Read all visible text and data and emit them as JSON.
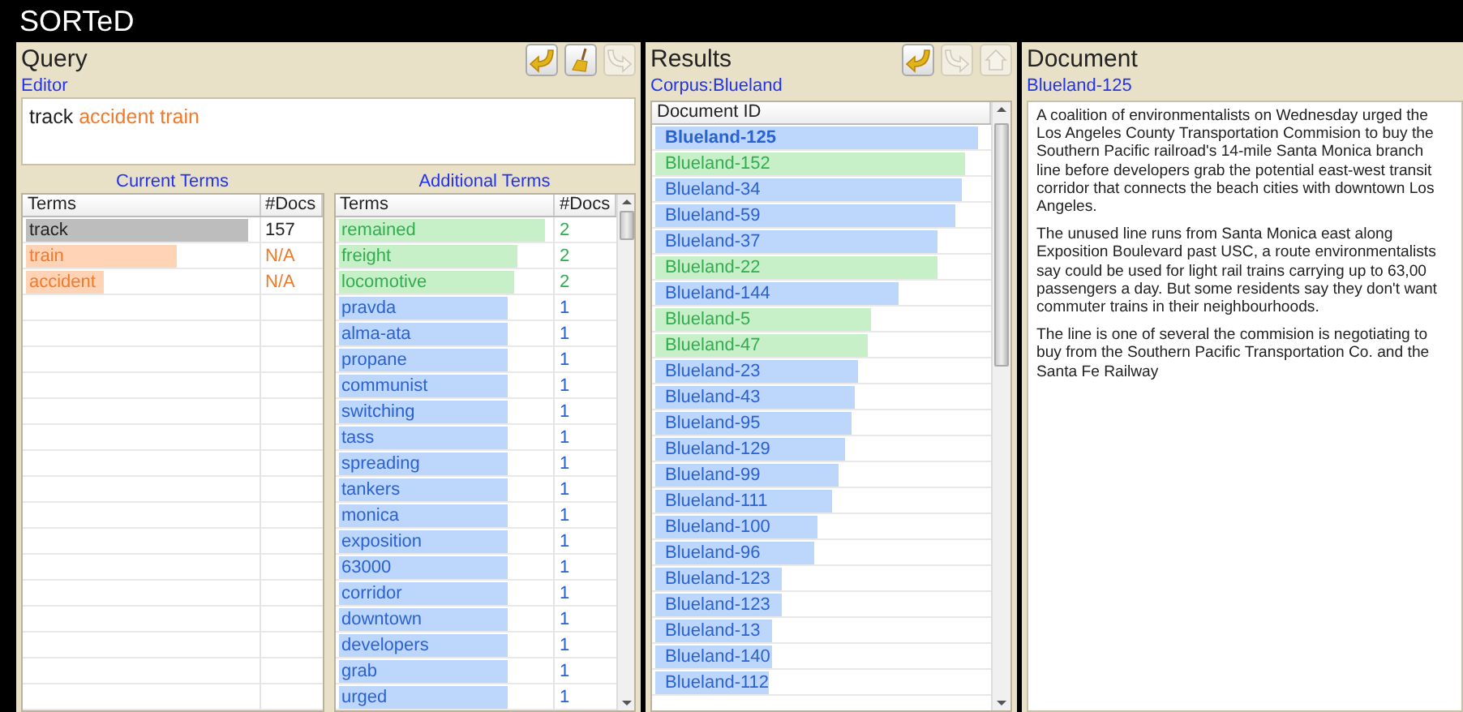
{
  "app": {
    "title": "SORTeD"
  },
  "query": {
    "title": "Query",
    "toolbar": [
      {
        "kind": "back",
        "disabled": false
      },
      {
        "kind": "clear",
        "disabled": false
      },
      {
        "kind": "forward",
        "disabled": true
      }
    ],
    "editor_label": "Editor",
    "editor_terms": [
      {
        "text": "track",
        "color": "#222222"
      },
      {
        "text": "accident",
        "color": "#f07a2a"
      },
      {
        "text": "train",
        "color": "#f07a2a"
      }
    ],
    "current_terms": {
      "heading": "Current Terms",
      "columns": [
        "Terms",
        "#Docs"
      ],
      "rows": [
        {
          "term": "track",
          "docs": "157",
          "level": 0.97,
          "color": "#bdbdbd"
        },
        {
          "term": "train",
          "docs": "N/A",
          "level": 0.66,
          "color": "#ffd3b5"
        },
        {
          "term": "accident",
          "docs": "N/A",
          "level": 0.34,
          "color": "#ffd3b5"
        }
      ]
    },
    "additional_terms": {
      "heading": "Additional Terms",
      "columns": [
        "Terms",
        "#Docs"
      ],
      "rows": [
        {
          "term": "remained",
          "docs": "2",
          "level": 0.98,
          "color": "#c8f0c8"
        },
        {
          "term": "freight",
          "docs": "2",
          "level": 0.85,
          "color": "#c8f0c8"
        },
        {
          "term": "locomotive",
          "docs": "2",
          "level": 0.83,
          "color": "#c8f0c8"
        },
        {
          "term": "pravda",
          "docs": "1",
          "level": 0.8,
          "color": "#bcd6fc"
        },
        {
          "term": "alma-ata",
          "docs": "1",
          "level": 0.8,
          "color": "#bcd6fc"
        },
        {
          "term": "propane",
          "docs": "1",
          "level": 0.8,
          "color": "#bcd6fc"
        },
        {
          "term": "communist",
          "docs": "1",
          "level": 0.8,
          "color": "#bcd6fc"
        },
        {
          "term": "switching",
          "docs": "1",
          "level": 0.8,
          "color": "#bcd6fc"
        },
        {
          "term": "tass",
          "docs": "1",
          "level": 0.8,
          "color": "#bcd6fc"
        },
        {
          "term": "spreading",
          "docs": "1",
          "level": 0.8,
          "color": "#bcd6fc"
        },
        {
          "term": "tankers",
          "docs": "1",
          "level": 0.8,
          "color": "#bcd6fc"
        },
        {
          "term": "monica",
          "docs": "1",
          "level": 0.8,
          "color": "#bcd6fc"
        },
        {
          "term": "exposition",
          "docs": "1",
          "level": 0.8,
          "color": "#bcd6fc"
        },
        {
          "term": "63000",
          "docs": "1",
          "level": 0.8,
          "color": "#bcd6fc"
        },
        {
          "term": "corridor",
          "docs": "1",
          "level": 0.8,
          "color": "#bcd6fc"
        },
        {
          "term": "downtown",
          "docs": "1",
          "level": 0.8,
          "color": "#bcd6fc"
        },
        {
          "term": "developers",
          "docs": "1",
          "level": 0.8,
          "color": "#bcd6fc"
        },
        {
          "term": "grab",
          "docs": "1",
          "level": 0.8,
          "color": "#bcd6fc"
        },
        {
          "term": "urged",
          "docs": "1",
          "level": 0.8,
          "color": "#bcd6fc"
        }
      ]
    }
  },
  "results": {
    "title": "Results",
    "toolbar": [
      {
        "kind": "back",
        "disabled": false
      },
      {
        "kind": "forward",
        "disabled": true
      },
      {
        "kind": "home",
        "disabled": true
      }
    ],
    "corpus_label": "Corpus:Blueland",
    "column": "Document ID",
    "rows": [
      {
        "id": "Blueland-125",
        "level": 0.97,
        "color": "#bcd6fc",
        "selected": true
      },
      {
        "id": "Blueland-152",
        "level": 0.93,
        "color": "#c8f0c8",
        "selected": false
      },
      {
        "id": "Blueland-34",
        "level": 0.92,
        "color": "#bcd6fc",
        "selected": false
      },
      {
        "id": "Blueland-59",
        "level": 0.9,
        "color": "#bcd6fc",
        "selected": false
      },
      {
        "id": "Blueland-37",
        "level": 0.85,
        "color": "#bcd6fc",
        "selected": false
      },
      {
        "id": "Blueland-22",
        "level": 0.85,
        "color": "#c8f0c8",
        "selected": false
      },
      {
        "id": "Blueland-144",
        "level": 0.73,
        "color": "#bcd6fc",
        "selected": false
      },
      {
        "id": "Blueland-5",
        "level": 0.65,
        "color": "#c8f0c8",
        "selected": false
      },
      {
        "id": "Blueland-47",
        "level": 0.64,
        "color": "#c8f0c8",
        "selected": false
      },
      {
        "id": "Blueland-23",
        "level": 0.61,
        "color": "#bcd6fc",
        "selected": false
      },
      {
        "id": "Blueland-43",
        "level": 0.6,
        "color": "#bcd6fc",
        "selected": false
      },
      {
        "id": "Blueland-95",
        "level": 0.59,
        "color": "#bcd6fc",
        "selected": false
      },
      {
        "id": "Blueland-129",
        "level": 0.57,
        "color": "#bcd6fc",
        "selected": false
      },
      {
        "id": "Blueland-99",
        "level": 0.55,
        "color": "#bcd6fc",
        "selected": false
      },
      {
        "id": "Blueland-111",
        "level": 0.53,
        "color": "#bcd6fc",
        "selected": false
      },
      {
        "id": "Blueland-100",
        "level": 0.49,
        "color": "#bcd6fc",
        "selected": false
      },
      {
        "id": "Blueland-96",
        "level": 0.48,
        "color": "#bcd6fc",
        "selected": false
      },
      {
        "id": "Blueland-123",
        "level": 0.38,
        "color": "#bcd6fc",
        "selected": false
      },
      {
        "id": "Blueland-123",
        "level": 0.38,
        "color": "#bcd6fc",
        "selected": false
      },
      {
        "id": "Blueland-13",
        "level": 0.35,
        "color": "#bcd6fc",
        "selected": false
      },
      {
        "id": "Blueland-140",
        "level": 0.35,
        "color": "#bcd6fc",
        "selected": false
      },
      {
        "id": "Blueland-112",
        "level": 0.34,
        "color": "#bcd6fc",
        "selected": false
      }
    ]
  },
  "document": {
    "title": "Document",
    "doc_id": "Blueland-125",
    "paragraphs": [
      [
        "A coalition of environmentalists on Wednesday urged the",
        "Los Angeles County Transportation Commision to buy the",
        "Southern Pacific railroad's 14-mile Santa Monica branch",
        "line before developers grab the potential east-west transit",
        "corridor that connects the beach cities with downtown Los",
        "Angeles."
      ],
      [
        "The unused line runs from Santa Monica east along",
        "Exposition Boulevard past USC, a route environmentalists",
        "say could be used for light rail trains carrying up to 63,00",
        "passengers a day. But some residents say they don't want",
        "commuter trains in their neighbourhoods."
      ],
      [
        "The line is one of several the commision is negotiating to",
        "buy from the Southern Pacific Transportation Co. and the",
        "Santa Fe Railway"
      ]
    ]
  }
}
